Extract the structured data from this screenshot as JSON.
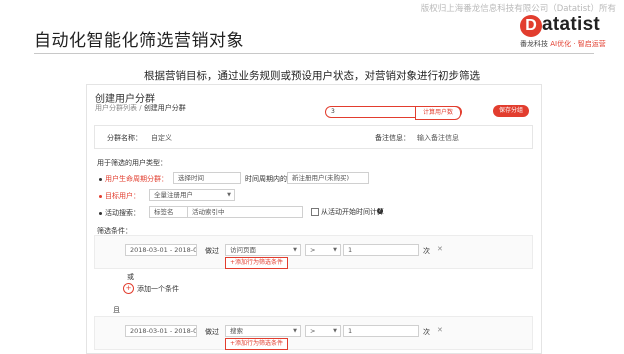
{
  "copyright": "版权归上海番龙信息科技有限公司（Datatist）所有",
  "slide": {
    "title": "自动化智能化筛选营销对象",
    "subtitle": "根据营销目标，通过业务规则或预设用户状态，对营销对象进行初步筛选"
  },
  "logo": {
    "mark": "D",
    "name": "atatist",
    "sub_company": "番龙科技",
    "sub_slogan": "AI优化 · 智启运营"
  },
  "ui": {
    "page_title": "创建用户分群",
    "breadcrumb_parent": "用户分群列表",
    "breadcrumb_sep": " / ",
    "breadcrumb_current": "创建用户分群",
    "search_value": "3",
    "search_button": "计算用户数",
    "save_button": "保存分组",
    "group_name_label": "分群名称：",
    "group_name_value": "自定义",
    "remark_label": "备注信息：",
    "remark_placeholder": "输入备注信息",
    "user_type_heading": "用于筛选的用户类型：",
    "lifecycle_label": "用户生命周期分群：",
    "lifecycle_placeholder": "选择时间",
    "time_period_label": "时间周期内的",
    "time_period_value": "新注册用户(未购买)",
    "target_user_label": "目标用户：",
    "target_user_value": "全量注册用户",
    "activity_label": "活动搜索：",
    "activity_field1": "标签名",
    "activity_field2": "活动索引中",
    "checkbox_label": "从活动开始时间计算",
    "filter_heading": "筛选条件：",
    "rule1": {
      "date": "2018-03-01 - 2018-05-0",
      "verb": "做过",
      "action": "访问页面",
      "operator": ">",
      "value": "1",
      "unit": "次",
      "add_condition": "+添加行为筛选条件"
    },
    "or_label": "或",
    "add_one_condition": "添加一个条件",
    "and_label": "且",
    "rule2": {
      "date": "2018-03-01 - 2018-05-0",
      "verb": "做过",
      "action": "搜索",
      "operator": ">",
      "value": "1",
      "unit": "次",
      "add_condition": "+添加行为筛选条件"
    }
  },
  "colors": {
    "accent": "#e23d2e"
  }
}
